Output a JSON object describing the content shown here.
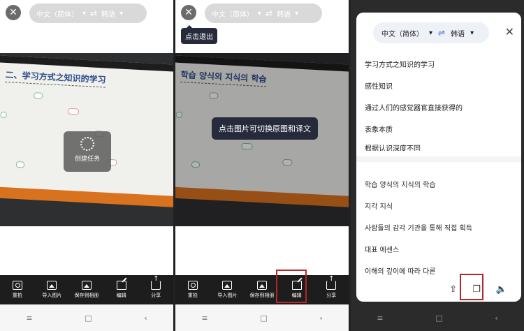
{
  "lang": {
    "source": "中文（简体）",
    "target": "韩语"
  },
  "tooltip_exit": "点击退出",
  "loading_text": "创建任务",
  "toast_text": "点击图片可切换原图和译文",
  "photo_title_zh": "二、学习方式之知识的学习",
  "photo_title_ko": "학습 양식의 지식의 학습",
  "toolbar": {
    "retake": "重拍",
    "import": "导入图片",
    "save": "保存到相册",
    "edit": "编辑",
    "share": "分享"
  },
  "icons": {
    "close": "close-icon",
    "swap": "swap-icon",
    "camera": "camera-icon",
    "image_add": "image-add-icon",
    "image_save": "image-save-icon",
    "edit": "edit-icon",
    "share": "share-icon",
    "copy": "copy-icon",
    "speaker": "speaker-icon"
  },
  "navbar": {
    "menu": "≡",
    "home": "□",
    "back": "‹"
  },
  "translation": {
    "source_lines": [
      "学习方式之知识的学习",
      "感性知识",
      "通过人们的感觉器官直接获得的",
      "表象本质",
      "根据认识深度不同"
    ],
    "target_lines": [
      "학습 양식의 지식의 학습",
      "지각 지식",
      "사람들의 감각 기관을 통해 직접 획득",
      "대표 에센스",
      "이해의 깊이에 따라 다른"
    ]
  },
  "colors": {
    "accent": "#3b6fd8",
    "highlight": "#b3262a",
    "toolbar_bg": "#1d1d1d"
  }
}
